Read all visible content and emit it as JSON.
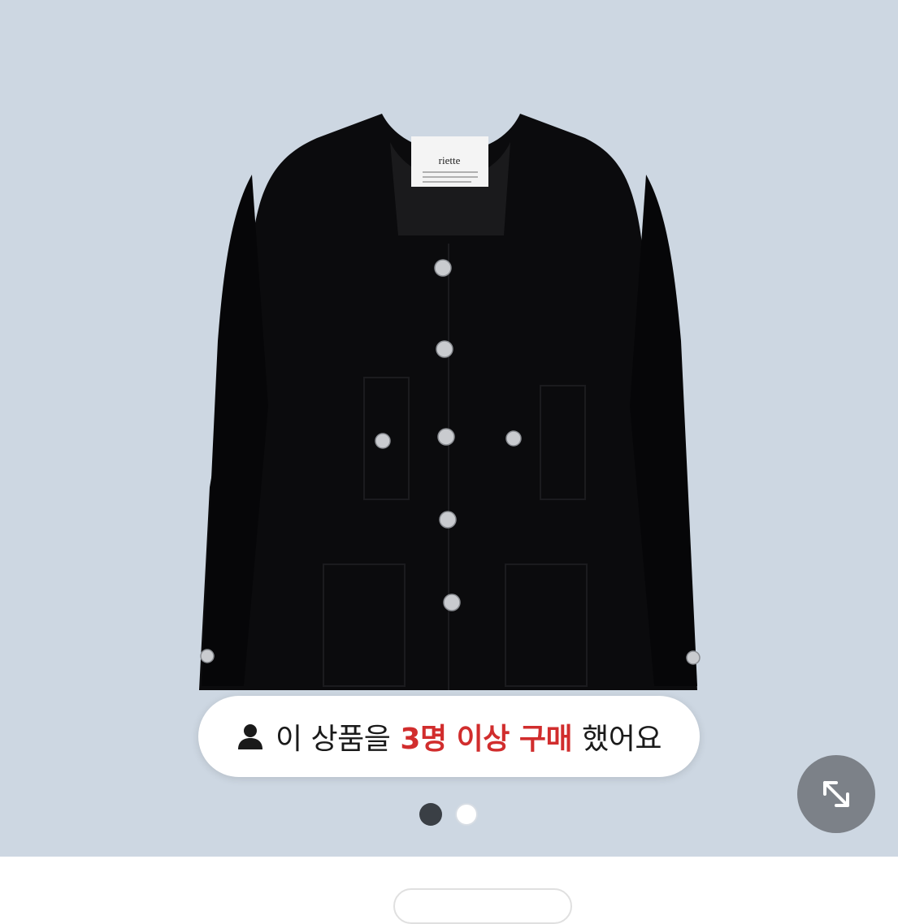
{
  "product": {
    "brand_label": "riette",
    "colors": {
      "background": "#cdd7e2",
      "jacket": "#0b0b0d",
      "button": "#c9cbcf"
    }
  },
  "purchase_badge": {
    "prefix": "이 상품을",
    "highlight": "3명 이상 구매",
    "suffix": "했어요",
    "icon": "user-icon",
    "highlight_color": "#d12d2d"
  },
  "carousel": {
    "total": 2,
    "active_index": 0
  },
  "expand_button": {
    "icon": "expand-icon"
  }
}
